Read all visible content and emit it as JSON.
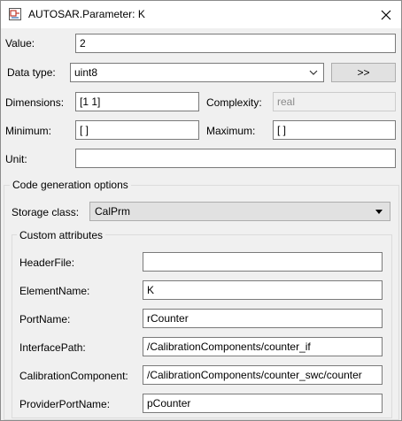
{
  "window": {
    "title": "AUTOSAR.Parameter: K"
  },
  "fields": {
    "value": {
      "label": "Value:",
      "value": "2"
    },
    "data_type": {
      "label": "Data type:",
      "value": "uint8",
      "button": ">>"
    },
    "dimensions": {
      "label": "Dimensions:",
      "value": "[1 1]"
    },
    "complexity": {
      "label": "Complexity:",
      "value": "real"
    },
    "minimum": {
      "label": "Minimum:",
      "value": "[ ]"
    },
    "maximum": {
      "label": "Maximum:",
      "value": "[ ]"
    },
    "unit": {
      "label": "Unit:",
      "value": ""
    }
  },
  "codegen": {
    "title": "Code generation options",
    "storage_class": {
      "label": "Storage class:",
      "value": "CalPrm"
    },
    "custom": {
      "title": "Custom attributes",
      "rows": [
        {
          "label": "HeaderFile:",
          "value": ""
        },
        {
          "label": "ElementName:",
          "value": "K"
        },
        {
          "label": "PortName:",
          "value": "rCounter"
        },
        {
          "label": "InterfacePath:",
          "value": "/CalibrationComponents/counter_if"
        },
        {
          "label": "CalibrationComponent:",
          "value": "/CalibrationComponents/counter_swc/counter"
        },
        {
          "label": "ProviderPortName:",
          "value": "pCounter"
        }
      ]
    }
  }
}
